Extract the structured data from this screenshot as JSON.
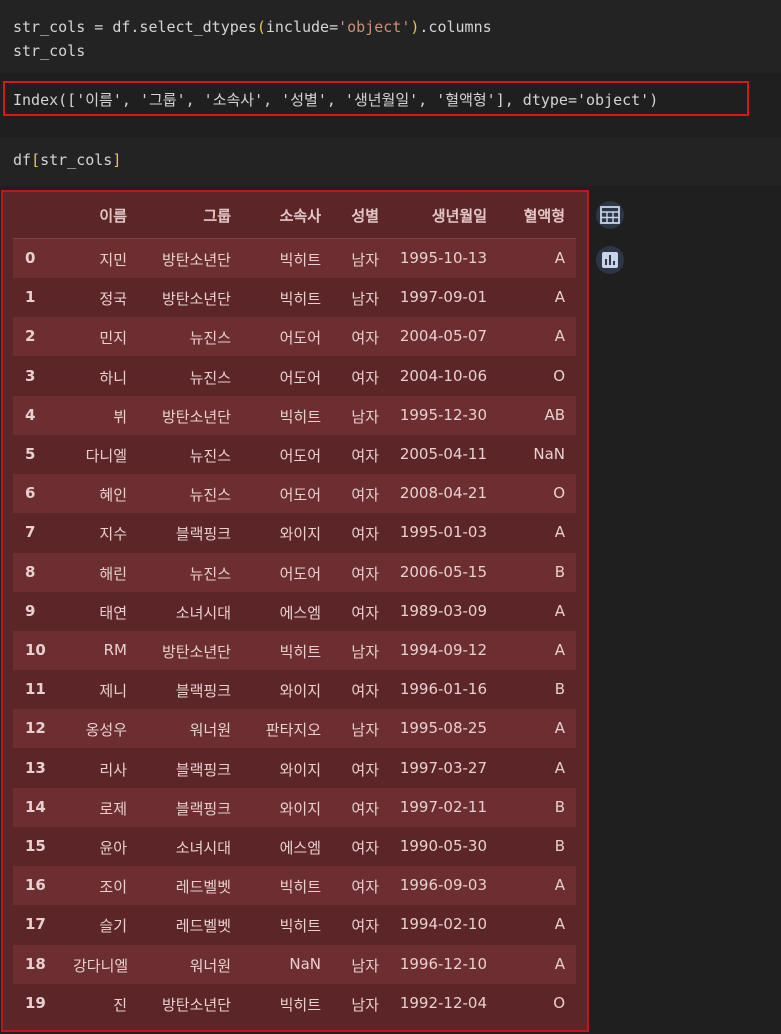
{
  "cell1": {
    "line1": {
      "part1": "str_cols = df.select_dtypes",
      "open": "(",
      "part2": "include=",
      "str": "'object'",
      "close": ")",
      "part3": ".columns"
    },
    "line2": "str_cols"
  },
  "output1": "Index(['이름', '그룹', '소속사', '성별', '생년월일', '혈액형'], dtype='object')",
  "cell2": {
    "prefix": "df",
    "open": "[",
    "inner": "str_cols",
    "close": "]"
  },
  "icons": {
    "table_icon": "table-icon",
    "chart_icon": "bar-chart-icon"
  },
  "table": {
    "headers": [
      "이름",
      "그룹",
      "소속사",
      "성별",
      "생년월일",
      "혈액형"
    ],
    "rows": [
      {
        "index": "0",
        "name": "지민",
        "group": "방탄소년단",
        "agency": "빅히트",
        "gender": "남자",
        "birth": "1995-10-13",
        "blood": "A"
      },
      {
        "index": "1",
        "name": "정국",
        "group": "방탄소년단",
        "agency": "빅히트",
        "gender": "남자",
        "birth": "1997-09-01",
        "blood": "A"
      },
      {
        "index": "2",
        "name": "민지",
        "group": "뉴진스",
        "agency": "어도어",
        "gender": "여자",
        "birth": "2004-05-07",
        "blood": "A"
      },
      {
        "index": "3",
        "name": "하니",
        "group": "뉴진스",
        "agency": "어도어",
        "gender": "여자",
        "birth": "2004-10-06",
        "blood": "O"
      },
      {
        "index": "4",
        "name": "뷔",
        "group": "방탄소년단",
        "agency": "빅히트",
        "gender": "남자",
        "birth": "1995-12-30",
        "blood": "AB"
      },
      {
        "index": "5",
        "name": "다니엘",
        "group": "뉴진스",
        "agency": "어도어",
        "gender": "여자",
        "birth": "2005-04-11",
        "blood": "NaN"
      },
      {
        "index": "6",
        "name": "혜인",
        "group": "뉴진스",
        "agency": "어도어",
        "gender": "여자",
        "birth": "2008-04-21",
        "blood": "O"
      },
      {
        "index": "7",
        "name": "지수",
        "group": "블랙핑크",
        "agency": "와이지",
        "gender": "여자",
        "birth": "1995-01-03",
        "blood": "A"
      },
      {
        "index": "8",
        "name": "해린",
        "group": "뉴진스",
        "agency": "어도어",
        "gender": "여자",
        "birth": "2006-05-15",
        "blood": "B"
      },
      {
        "index": "9",
        "name": "태연",
        "group": "소녀시대",
        "agency": "에스엠",
        "gender": "여자",
        "birth": "1989-03-09",
        "blood": "A"
      },
      {
        "index": "10",
        "name": "RM",
        "group": "방탄소년단",
        "agency": "빅히트",
        "gender": "남자",
        "birth": "1994-09-12",
        "blood": "A"
      },
      {
        "index": "11",
        "name": "제니",
        "group": "블랙핑크",
        "agency": "와이지",
        "gender": "여자",
        "birth": "1996-01-16",
        "blood": "B"
      },
      {
        "index": "12",
        "name": "옹성우",
        "group": "워너원",
        "agency": "판타지오",
        "gender": "남자",
        "birth": "1995-08-25",
        "blood": "A"
      },
      {
        "index": "13",
        "name": "리사",
        "group": "블랙핑크",
        "agency": "와이지",
        "gender": "여자",
        "birth": "1997-03-27",
        "blood": "A"
      },
      {
        "index": "14",
        "name": "로제",
        "group": "블랙핑크",
        "agency": "와이지",
        "gender": "여자",
        "birth": "1997-02-11",
        "blood": "B"
      },
      {
        "index": "15",
        "name": "윤아",
        "group": "소녀시대",
        "agency": "에스엠",
        "gender": "여자",
        "birth": "1990-05-30",
        "blood": "B"
      },
      {
        "index": "16",
        "name": "조이",
        "group": "레드벨벳",
        "agency": "빅히트",
        "gender": "여자",
        "birth": "1996-09-03",
        "blood": "A"
      },
      {
        "index": "17",
        "name": "슬기",
        "group": "레드벨벳",
        "agency": "빅히트",
        "gender": "여자",
        "birth": "1994-02-10",
        "blood": "A"
      },
      {
        "index": "18",
        "name": "강다니엘",
        "group": "워너원",
        "agency": "NaN",
        "gender": "남자",
        "birth": "1996-12-10",
        "blood": "A"
      },
      {
        "index": "19",
        "name": "진",
        "group": "방탄소년단",
        "agency": "빅히트",
        "gender": "남자",
        "birth": "1992-12-04",
        "blood": "O"
      }
    ]
  }
}
